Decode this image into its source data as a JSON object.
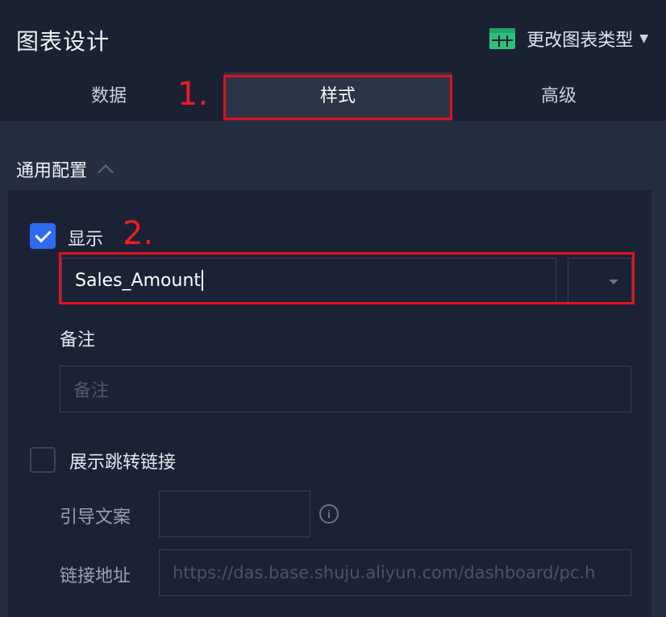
{
  "header": {
    "title": "图表设计",
    "change_type_label": "更改图表类型"
  },
  "tabs": [
    {
      "label": "数据"
    },
    {
      "label": "样式",
      "active": true
    },
    {
      "label": "高级"
    }
  ],
  "annotations": [
    "1.",
    "2."
  ],
  "section": {
    "title": "通用配置"
  },
  "display": {
    "label": "显示",
    "checked": true,
    "value": "Sales_Amount"
  },
  "remark": {
    "label": "备注",
    "placeholder": "备注"
  },
  "jump_link": {
    "label": "展示跳转链接",
    "checked": false,
    "guide_label": "引导文案",
    "url_label": "链接地址",
    "url_placeholder": "https://das.base.shuju.aliyun.com/dashboard/pc.h"
  },
  "colors": {
    "accent": "#2f6bf0",
    "annotation_red": "#e3101c",
    "icon_green": "#2fbd7c"
  }
}
